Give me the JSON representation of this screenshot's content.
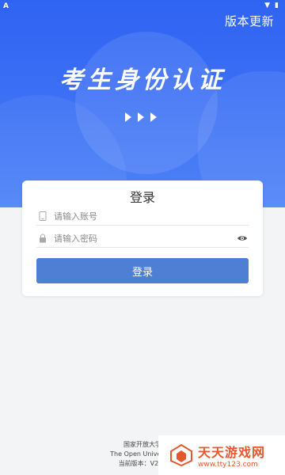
{
  "header": {
    "update_label": "版本更新",
    "title": "考生身份认证"
  },
  "card": {
    "title": "登录",
    "account_placeholder": "请输入账号",
    "password_placeholder": "请输入密码",
    "login_button": "登录"
  },
  "footer": {
    "line1": "国家开放大学",
    "line2": "The Open University",
    "line3": "当前版本：V2.4."
  },
  "watermark": {
    "name": "天天游戏网",
    "url": "www.tty123.com"
  },
  "colors": {
    "primary": "#2f63f2",
    "button": "#4e7fd4",
    "watermark": "#e5582c"
  }
}
